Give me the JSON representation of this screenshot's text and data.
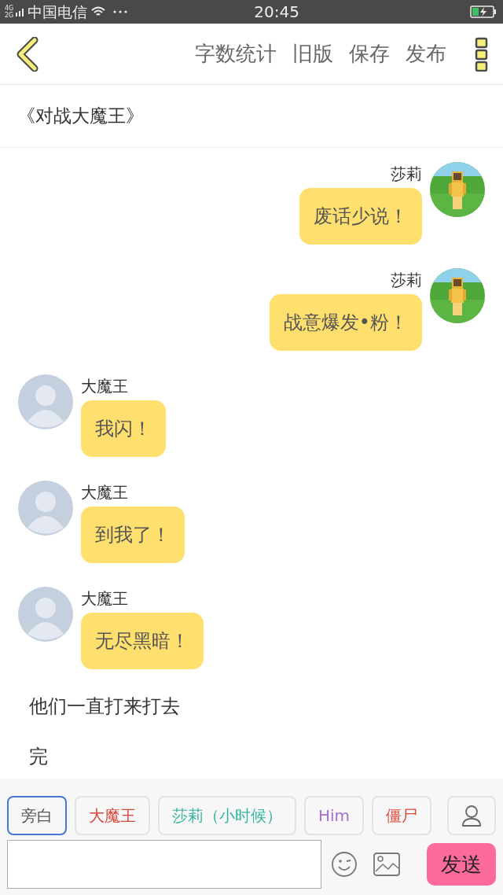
{
  "status_bar": {
    "network": [
      "4G",
      "2G"
    ],
    "carrier": "中国电信",
    "time": "20:45",
    "charging": true
  },
  "header": {
    "actions": [
      "字数统计",
      "旧版",
      "保存",
      "发布"
    ]
  },
  "story_title": "《对战大魔王》",
  "messages": [
    {
      "kind": "right",
      "speaker": "莎莉",
      "text": "废话少说！"
    },
    {
      "kind": "right",
      "speaker": "莎莉",
      "text": "战意爆发•粉！"
    },
    {
      "kind": "left",
      "speaker": "大魔王",
      "text": "我闪！"
    },
    {
      "kind": "left",
      "speaker": "大魔王",
      "text": "到我了！"
    },
    {
      "kind": "left",
      "speaker": "大魔王",
      "text": "无尽黑暗！"
    },
    {
      "kind": "narration",
      "text": "他们一直打来打去"
    },
    {
      "kind": "narration",
      "text": "完"
    }
  ],
  "characters": [
    {
      "label": "旁白",
      "color": "#555555",
      "selected": true
    },
    {
      "label": "大魔王",
      "color": "#d9473a",
      "selected": false
    },
    {
      "label": "莎莉（小时候）",
      "color": "#35b5a0",
      "selected": false
    },
    {
      "label": "Him",
      "color": "#a86fd0",
      "selected": false
    },
    {
      "label": "僵尸",
      "color": "#d9473a",
      "selected": false
    }
  ],
  "composer": {
    "send": "发送"
  }
}
